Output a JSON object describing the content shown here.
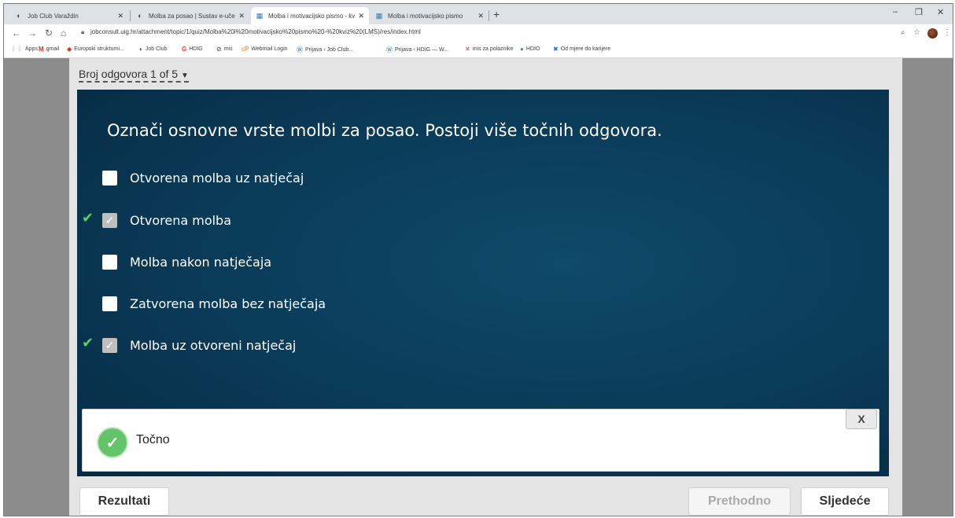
{
  "browser": {
    "tabs": [
      {
        "title": "Job Club Varaždin",
        "icon": "circle-logo-icon"
      },
      {
        "title": "Molba za posao | Sustav e-učenj",
        "icon": "circle-logo-icon"
      },
      {
        "title": "Molba i motivacijsko pismo - kvi",
        "icon": "page-icon"
      },
      {
        "title": "Molba i motivacijsko pismo",
        "icon": "page-icon"
      }
    ],
    "url": "jobconsult.uig.hr/attachment/topic/1/quiz/Molba%20i%20motivacijsko%20pismo%20-%20kviz%20(LMS)/res/index.html",
    "bookmarks": [
      "Apps",
      "gmail",
      "Europski strukturni...",
      "Job Club",
      "HDIG",
      "mis",
      "Webmail Login",
      "Prijava ‹ Job Club...",
      "Prijava ‹ HDIG — W...",
      "mis za polaznike",
      "HDIO",
      "Od mjere do karijere"
    ]
  },
  "quiz": {
    "counter": "Broj odgovora 1 of 5",
    "question": "Označi osnovne vrste molbi za posao. Postoji više točnih odgovora.",
    "options": [
      {
        "label": "Otvorena molba uz natječaj",
        "checked": false,
        "correct": false
      },
      {
        "label": "Otvorena molba",
        "checked": true,
        "correct": true
      },
      {
        "label": "Molba nakon natječaja",
        "checked": false,
        "correct": false
      },
      {
        "label": "Zatvorena molba bez natječaja",
        "checked": false,
        "correct": false
      },
      {
        "label": "Molba uz otvoreni natječaj",
        "checked": true,
        "correct": true
      }
    ],
    "feedback": {
      "text": "Točno",
      "close": "X"
    },
    "buttons": {
      "results": "Rezultati",
      "previous": "Prethodno",
      "next": "Sljedeće"
    }
  },
  "colors": {
    "panel": "#0a3a57",
    "correct": "#5cd05c"
  }
}
